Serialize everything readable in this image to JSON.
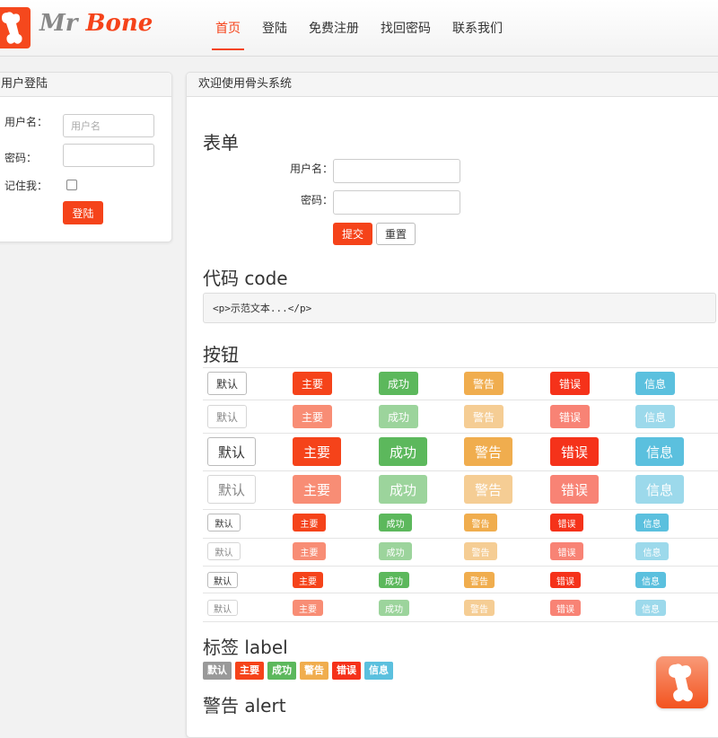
{
  "header": {
    "logo_text_a": "Mr ",
    "logo_text_b": "Bone",
    "nav": [
      {
        "label": "首页",
        "active": true
      },
      {
        "label": "登陆",
        "active": false
      },
      {
        "label": "免费注册",
        "active": false
      },
      {
        "label": "找回密码",
        "active": false
      },
      {
        "label": "联系我们",
        "active": false
      }
    ]
  },
  "login": {
    "title": "用户登陆",
    "username_label": "用户名：",
    "username_placeholder": "用户名",
    "password_label": "密码：",
    "remember_label": "记住我：",
    "submit_label": "登陆"
  },
  "main": {
    "title": "欢迎使用骨头系统",
    "form_heading": "表单",
    "form_username_label": "用户名：",
    "form_password_label": "密码：",
    "submit_label": "提交",
    "reset_label": "重置",
    "code_heading": "代码 code",
    "code_text": "<p>示范文本...</p>",
    "buttons_heading": "按钮",
    "button_labels": [
      "默认",
      "主要",
      "成功",
      "警告",
      "错误",
      "信息"
    ],
    "label_heading": "标签 label",
    "alert_heading": "警告 alert"
  },
  "colors": {
    "primary": "#f5431a",
    "success": "#5cb85c",
    "warning": "#f0ad4e",
    "danger": "#f5321a",
    "info": "#5bc0de",
    "default_label": "#999999"
  }
}
